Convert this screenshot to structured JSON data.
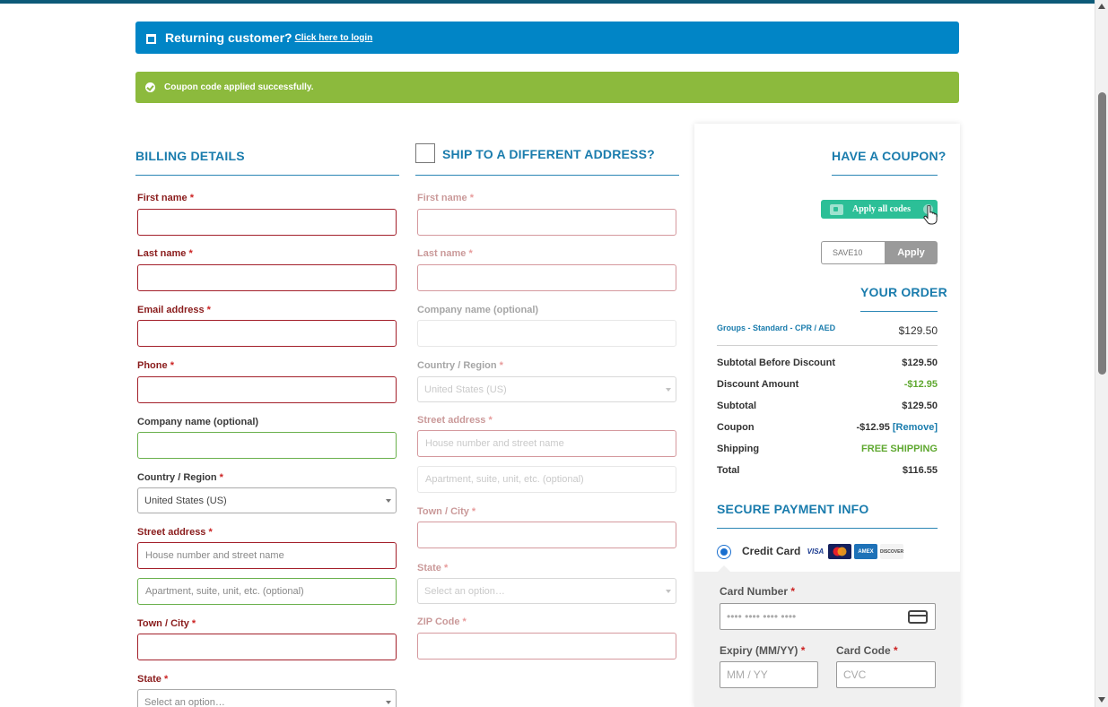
{
  "notices": {
    "returning_strong": "Returning customer?",
    "returning_link": "Click here to login",
    "coupon_applied": "Coupon code applied successfully."
  },
  "billing": {
    "heading": "BILLING DETAILS",
    "first_name": "First name",
    "last_name": "Last name",
    "email": "Email address",
    "phone": "Phone",
    "company": "Company name (optional)",
    "country": "Country / Region",
    "country_value": "United States (US)",
    "street": "Street address",
    "street_placeholder": "House number and street name",
    "apt_placeholder": "Apartment, suite, unit, etc. (optional)",
    "city": "Town / City",
    "state": "State",
    "state_value": "Select an option…",
    "required_mark": "*"
  },
  "shipping": {
    "heading": "SHIP TO A DIFFERENT ADDRESS?",
    "first_name": "First name",
    "last_name": "Last name",
    "company": "Company name (optional)",
    "country": "Country / Region",
    "country_value": "United States (US)",
    "street": "Street address",
    "street_placeholder": "House number and street name",
    "apt_placeholder": "Apartment, suite, unit, etc. (optional)",
    "city": "Town / City",
    "state": "State",
    "state_value": "Select an option…",
    "zip": "ZIP Code",
    "required_mark": "*"
  },
  "coupon": {
    "heading": "HAVE A COUPON?",
    "apply_all": "Apply all codes",
    "input_placeholder": "SAVE10",
    "apply": "Apply"
  },
  "order": {
    "heading": "YOUR ORDER",
    "item_name": "Groups - Standard - CPR / AED",
    "item_price": "$129.50",
    "rows": [
      {
        "label": "Subtotal Before Discount",
        "value": "$129.50"
      },
      {
        "label": "Discount Amount",
        "value": "-$12.95"
      },
      {
        "label": "Subtotal",
        "value": "$129.50"
      },
      {
        "label": "Coupon",
        "value": "-$12.95",
        "link": "[Remove]"
      },
      {
        "label": "Shipping",
        "value": "FREE SHIPPING"
      },
      {
        "label": "Total",
        "value": "$116.55"
      }
    ]
  },
  "payment": {
    "heading": "SECURE PAYMENT INFO",
    "method": "Credit Card",
    "card_logos": [
      "VISA",
      "mastercard-icon",
      "AMEX",
      "DISCOVER"
    ],
    "card_number_label": "Card Number",
    "card_number_placeholder": "•••• •••• •••• ••••",
    "expiry_label": "Expiry (MM/YY)",
    "expiry_placeholder": "MM / YY",
    "cvc_label": "Card Code",
    "cvc_placeholder": "CVC",
    "required_mark": "*"
  },
  "colors": {
    "notice_blue": "#0185c6",
    "notice_green": "#8cba3d",
    "heading_blue": "#1a7cad",
    "required_red": "#a31f2a",
    "valid_green": "#6ab04c",
    "apply_all_teal": "#2cbf97"
  }
}
